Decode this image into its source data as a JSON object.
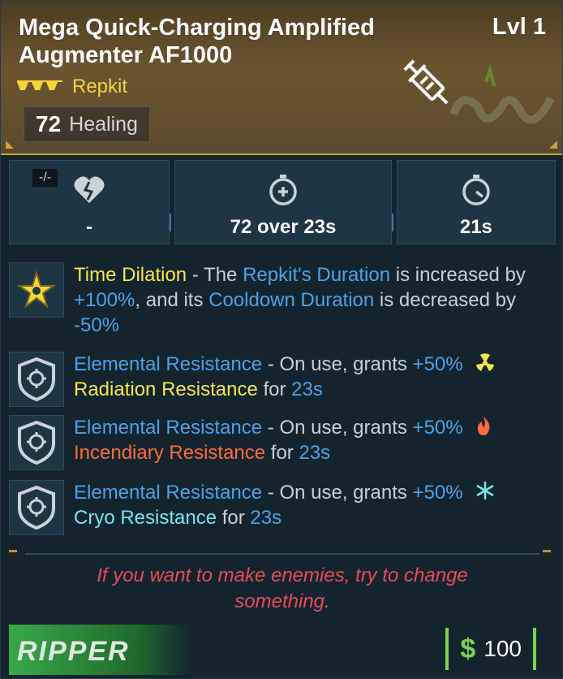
{
  "item": {
    "name": "Mega Quick-Charging Amplified Augmenter AF1000",
    "level": "Lvl 1",
    "type": "Repkit",
    "rarity_color": "#f4d63a",
    "healing_value": "72",
    "healing_label": "Healing"
  },
  "stats": {
    "tag": "-/-",
    "items": [
      {
        "icon": "broken-heart-icon",
        "value": "-"
      },
      {
        "icon": "timer-plus-icon",
        "value": "72 over 23s"
      },
      {
        "icon": "stopwatch-icon",
        "value": "21s"
      }
    ]
  },
  "perks": [
    {
      "icon": "star-burst-icon",
      "name": "Time Dilation",
      "text1": " - The ",
      "h1": "Repkit's Duration",
      "text2": " is increased by ",
      "h2": "+100%",
      "text3": ", and its ",
      "h3": "Cooldown Duration",
      "text4": " is decreased by ",
      "h4": "-50%"
    },
    {
      "icon": "shield-emblem-icon",
      "name": "Elemental Resistance",
      "text1": " - On use, grants ",
      "amount": "+50%",
      "element_icon": "radiation-icon",
      "resistance": "Radiation Resistance",
      "for": " for ",
      "duration": "23s",
      "color": "#f4e74a"
    },
    {
      "icon": "shield-emblem-icon",
      "name": "Elemental Resistance",
      "text1": " - On use, grants ",
      "amount": "+50%",
      "element_icon": "fire-icon",
      "resistance": "Incendiary Resistance",
      "for": " for ",
      "duration": "23s",
      "color": "#ff6a3a"
    },
    {
      "icon": "shield-emblem-icon",
      "name": "Elemental Resistance",
      "text1": " - On use, grants ",
      "amount": "+50%",
      "element_icon": "snowflake-icon",
      "resistance": "Cryo Resistance",
      "for": " for ",
      "duration": "23s",
      "color": "#6fe6f0"
    }
  ],
  "flavor": "If you want to make enemies, try to change something.",
  "manufacturer": "RIPPER",
  "price": {
    "symbol": "$",
    "value": "100"
  }
}
